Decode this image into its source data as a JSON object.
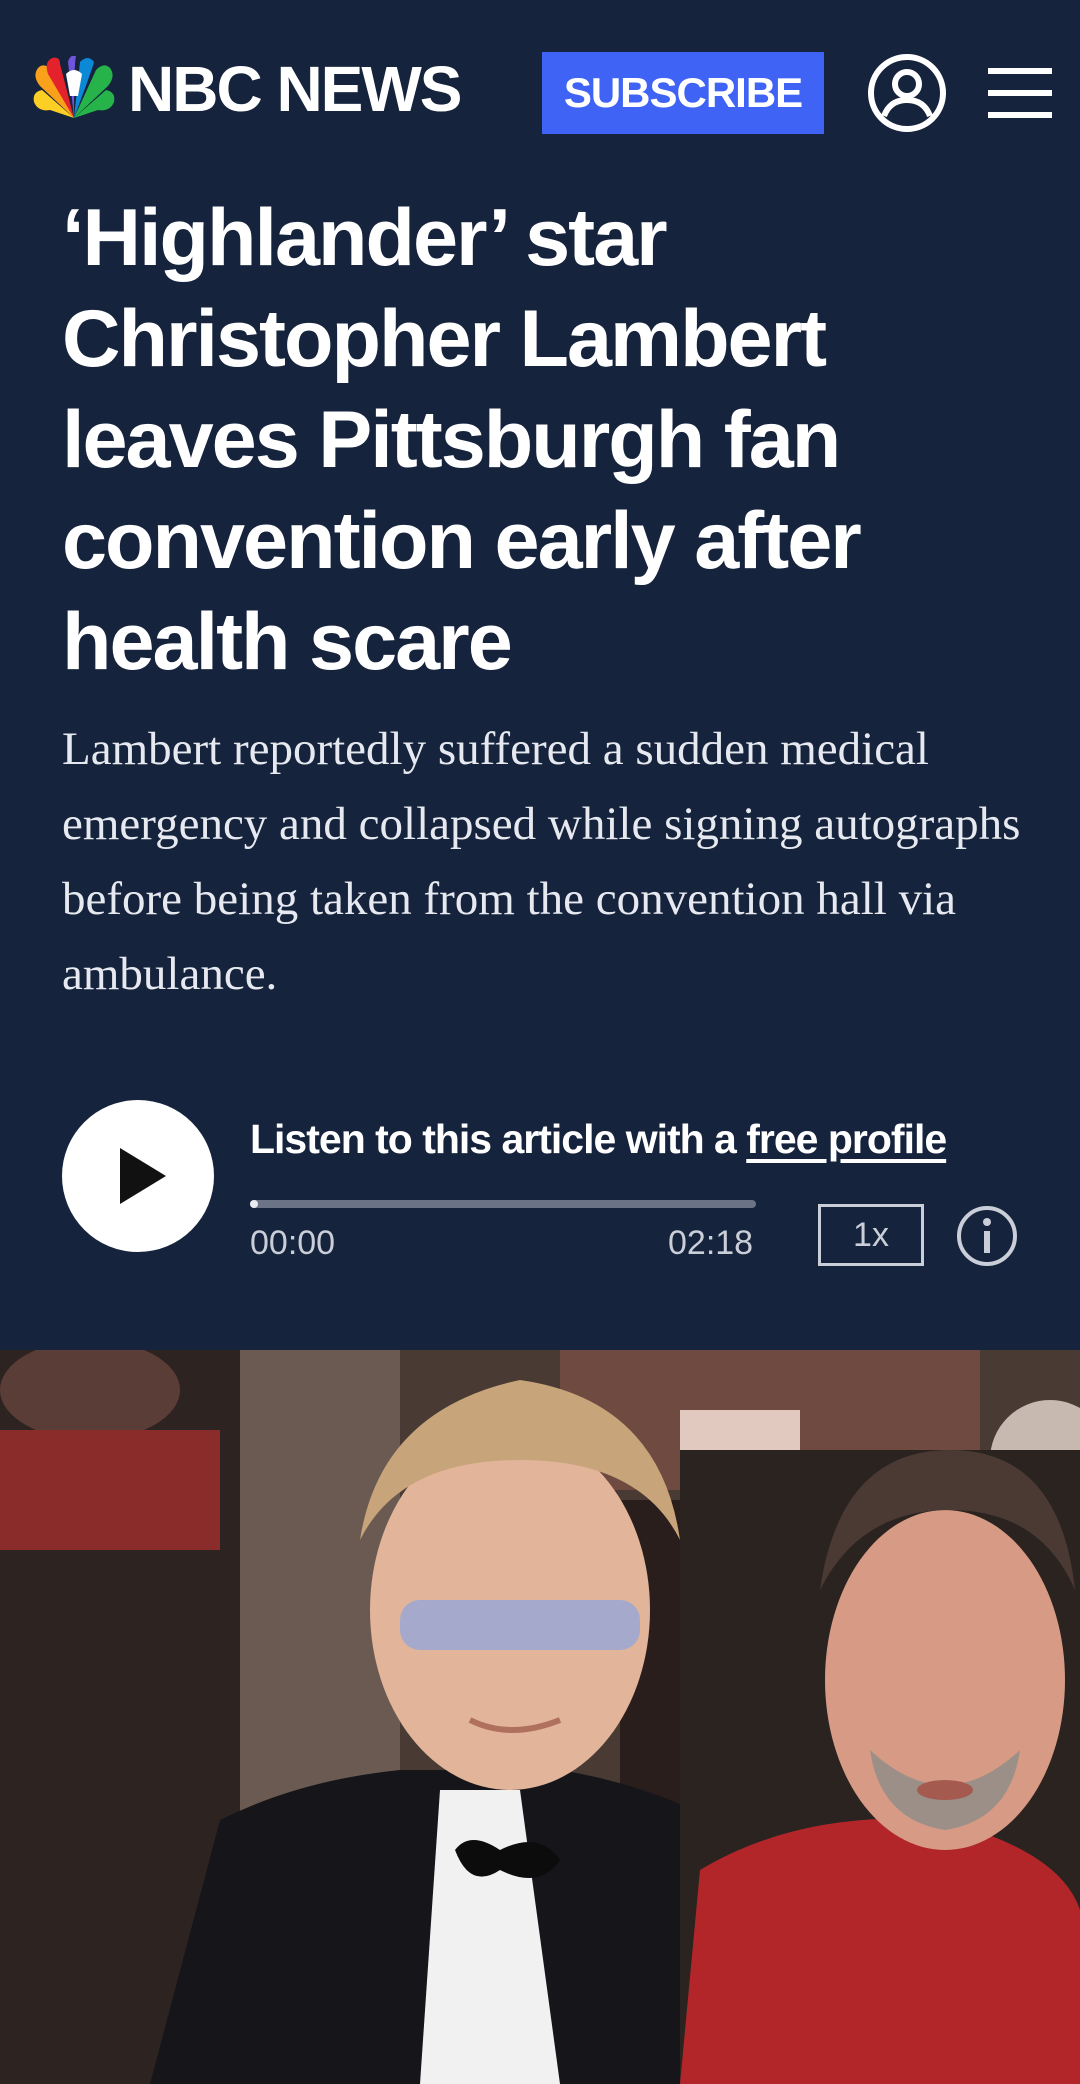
{
  "header": {
    "brand": "NBC NEWS",
    "subscribe_label": "SUBSCRIBE",
    "account_icon": "account-icon",
    "menu_icon": "hamburger-menu-icon"
  },
  "article": {
    "headline": "‘Highlander’ star Christopher Lambert leaves Pittsburgh fan convention early after health scare",
    "dek": "Lambert reportedly suffered a sudden medical emergency and collapsed while signing autographs before being taken from the convention hall via ambulance."
  },
  "audio_player": {
    "listen_prefix": "Listen to this article with a ",
    "listen_link": "free profile",
    "current_time": "00:00",
    "duration": "02:18",
    "speed": "1x",
    "progress_fraction": 0,
    "play_icon": "play-icon",
    "info_icon": "info-icon"
  },
  "colors": {
    "background": "#16233c",
    "subscribe_button": "#3e63f5",
    "text": "#ffffff"
  }
}
